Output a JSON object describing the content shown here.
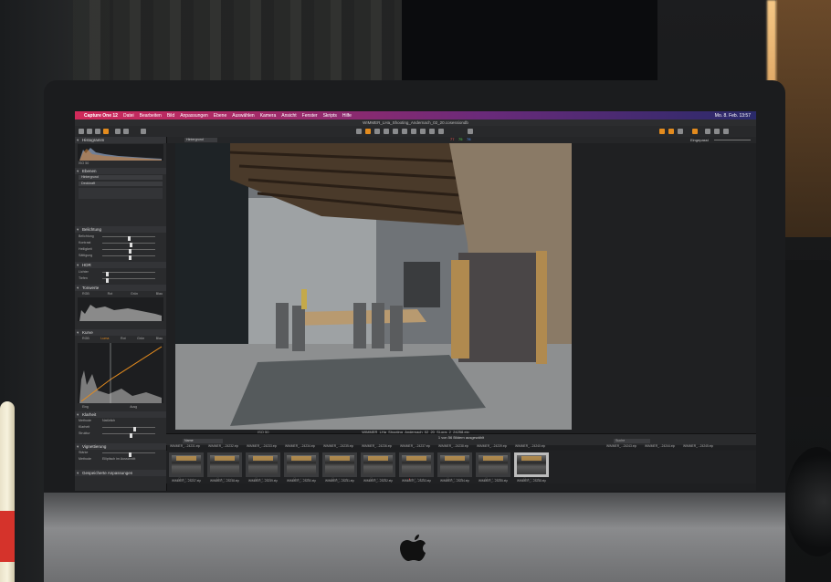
{
  "menubar": {
    "app": "Capture One 12",
    "items": [
      "Datei",
      "Bearbeiten",
      "Bild",
      "Anpassungen",
      "Ebene",
      "Auswählen",
      "Kamera",
      "Ansicht",
      "Fenster",
      "Skripts",
      "Hilfe"
    ],
    "clock": "Mo. 8. Feb. 13:57"
  },
  "window": {
    "title": "WIMMER_LHa_Shooting_Andernach_02_20.cosessiondb"
  },
  "viewer": {
    "chips": [
      "77",
      "75",
      "78"
    ],
    "zoom_label": "Eingepasst",
    "caption": "WIMMER_LHa_Shooting_Andernach_02_20_Sl-ops_2_24258.eip",
    "zoom_readout": "ISO 50",
    "filter_label": "Hintergrund"
  },
  "panel": {
    "sections": [
      {
        "label": "Histogramm"
      },
      {
        "label": "Ebenen"
      },
      {
        "label": "Belichtung"
      },
      {
        "label": "HDR"
      },
      {
        "label": "Tonwerte"
      },
      {
        "label": "Kurve"
      },
      {
        "label": "Klarheit"
      },
      {
        "label": "Vignettierung"
      },
      {
        "label": "Gespeicherte Anpassungen"
      }
    ],
    "hist_readout": "ISO 50",
    "layer_name": "Hintergrund",
    "opacity_label": "Deckkraft",
    "belichtung_rows": [
      "Belichtung",
      "Kontrast",
      "Helligkeit",
      "Sättigung"
    ],
    "hdr_rows": [
      "Lichter",
      "Tiefen"
    ],
    "tonwerte_tabs": [
      "RGB",
      "Rot",
      "Grün",
      "Blau"
    ],
    "kurve_tabs": [
      "RGB",
      "Luma",
      "Rot",
      "Grün",
      "Blau"
    ],
    "kurve_footer": [
      "Eing",
      "Ausg"
    ],
    "klarheit_rows": [
      "Methode",
      "Klarheit",
      "Struktur"
    ],
    "klarheit_method": "Natürlich",
    "vignette_rows": [
      "Stärke",
      "Methode"
    ],
    "vignette_method": "Elliptisch im Ausschnitt"
  },
  "browser": {
    "count_label": "1 von 56 Bildern ausgewählt",
    "sort_label": "Name",
    "search_label": "Suche",
    "top_names": [
      "WIMMER_...24231.eip",
      "WIMMER_...24232.eip",
      "WIMMER_...24233.eip",
      "WIMMER_...24234.eip",
      "WIMMER_...24235.eip",
      "WIMMER_...24236.eip",
      "WIMMER_...24237.eip",
      "WIMMER_...24238.eip",
      "WIMMER_...24239.eip",
      "WIMMER_...24240.eip",
      "WIMMER_...24243.eip",
      "WIMMER_...24244.eip",
      "WIMMER_...24245.eip"
    ],
    "thumbs": [
      {
        "name": "WIMMER_...24247.eip"
      },
      {
        "name": "WIMMER_...24248.eip"
      },
      {
        "name": "WIMMER_...24249.eip"
      },
      {
        "name": "WIMMER_...24250.eip"
      },
      {
        "name": "WIMMER_...24251.eip"
      },
      {
        "name": "WIMMER_...24252.eip"
      },
      {
        "name": "WIMMER_...24253.eip"
      },
      {
        "name": "WIMMER_...24254.eip"
      },
      {
        "name": "WIMMER_...24255.eip"
      },
      {
        "name": "WIMMER_...24258.eip",
        "selected": true
      }
    ]
  },
  "colors": {
    "accent": "#e38b1e",
    "menubar": "#d12a5a",
    "panel": "#2a2b2d"
  }
}
